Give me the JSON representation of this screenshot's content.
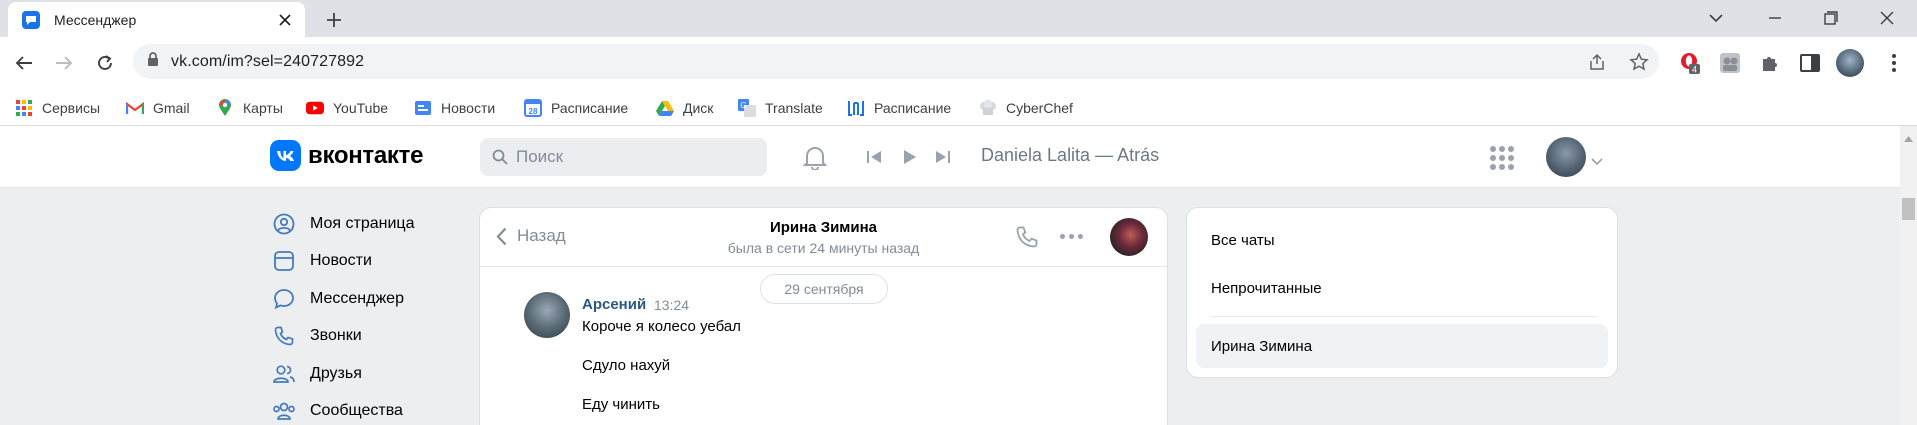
{
  "browser": {
    "tab_title": "Мессенджер",
    "url": "vk.com/im?sel=240727892",
    "extension_badge": "4"
  },
  "bookmarks": [
    {
      "label": "Сервисы",
      "icon": "apps-grid-icon"
    },
    {
      "label": "Gmail",
      "icon": "gmail-icon"
    },
    {
      "label": "Карты",
      "icon": "maps-pin-icon"
    },
    {
      "label": "YouTube",
      "icon": "youtube-icon"
    },
    {
      "label": "Новости",
      "icon": "news-icon"
    },
    {
      "label": "Расписание",
      "icon": "calendar-icon"
    },
    {
      "label": "Диск",
      "icon": "drive-icon"
    },
    {
      "label": "Translate",
      "icon": "translate-icon"
    },
    {
      "label": "Расписание",
      "icon": "schedule-icon"
    },
    {
      "label": "CyberChef",
      "icon": "chef-hat-icon"
    }
  ],
  "vk_header": {
    "logo_text": "вконтакте",
    "search_placeholder": "Поиск",
    "now_playing": "Daniela Lalita — Atrás"
  },
  "left_menu": [
    {
      "label": "Моя страница",
      "icon": "user-circle-icon"
    },
    {
      "label": "Новости",
      "icon": "news-feed-icon"
    },
    {
      "label": "Мессенджер",
      "icon": "message-bubble-icon"
    },
    {
      "label": "Звонки",
      "icon": "phone-icon"
    },
    {
      "label": "Друзья",
      "icon": "friends-icon"
    },
    {
      "label": "Сообщества",
      "icon": "communities-icon"
    }
  ],
  "chat": {
    "back_label": "Назад",
    "contact_name": "Ирина Зимина",
    "contact_status": "была в сети 24 минуты назад",
    "date_separator": "29 сентября",
    "message": {
      "author": "Арсений",
      "time": "13:24",
      "lines": [
        "Короче я колесо уебал",
        "Сдуло нахуй",
        "Еду чинить"
      ]
    }
  },
  "chat_filters": {
    "all": "Все чаты",
    "unread": "Непрочитанные",
    "selected": "Ирина Зимина"
  },
  "colors": {
    "vk_blue": "#0077ff",
    "author_link": "#2a5885",
    "muted": "#818c99"
  }
}
